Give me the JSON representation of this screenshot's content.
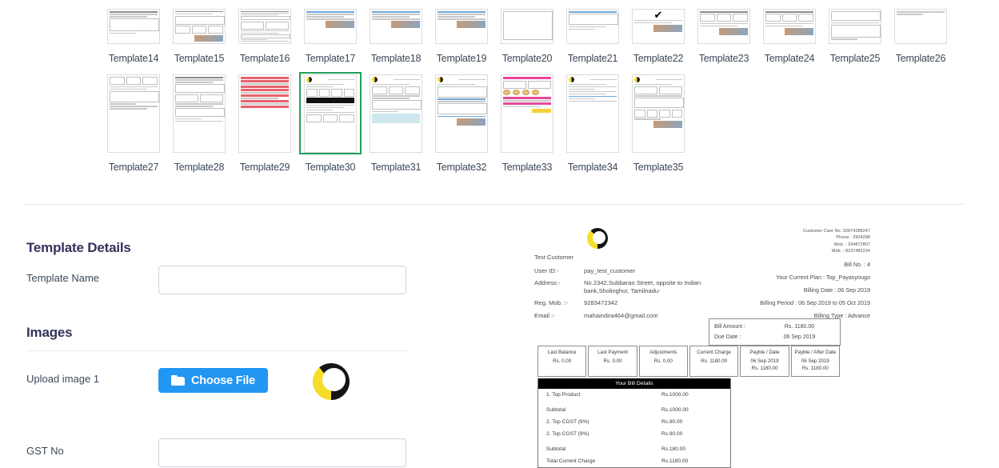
{
  "gallery": {
    "rows": [
      {
        "items": [
          {
            "label": "Template14",
            "selected": false,
            "art": "form-photo"
          },
          {
            "label": "Template15",
            "selected": false,
            "art": "table-photo"
          },
          {
            "label": "Template16",
            "selected": false,
            "art": "dense-form"
          },
          {
            "label": "Template17",
            "selected": false,
            "art": "blue-photo"
          },
          {
            "label": "Template18",
            "selected": false,
            "art": "blue-photo"
          },
          {
            "label": "Template19",
            "selected": false,
            "art": "blue-photo"
          },
          {
            "label": "Template20",
            "selected": false,
            "art": "plain-box"
          },
          {
            "label": "Template21",
            "selected": false,
            "art": "blue-table"
          },
          {
            "label": "Template22",
            "selected": false,
            "art": "check-photo"
          },
          {
            "label": "Template23",
            "selected": false,
            "art": "invoice-photo"
          },
          {
            "label": "Template24",
            "selected": false,
            "art": "invoice-photo"
          },
          {
            "label": "Template25",
            "selected": false,
            "art": "terms-table"
          },
          {
            "label": "Template26",
            "selected": false,
            "art": "faint"
          }
        ]
      },
      {
        "items": [
          {
            "label": "Template27",
            "selected": false,
            "art": "grey-table"
          },
          {
            "label": "Template28",
            "selected": false,
            "art": "dense-form"
          },
          {
            "label": "Template29",
            "selected": false,
            "art": "red-lines"
          },
          {
            "label": "Template30",
            "selected": true,
            "art": "brand-invoice"
          },
          {
            "label": "Template31",
            "selected": false,
            "art": "tint-invoice"
          },
          {
            "label": "Template32",
            "selected": false,
            "art": "blue-banded"
          },
          {
            "label": "Template33",
            "selected": false,
            "art": "pink-catalog"
          },
          {
            "label": "Template34",
            "selected": false,
            "art": "brand-letter"
          },
          {
            "label": "Template35",
            "selected": false,
            "art": "grid-invoice"
          }
        ]
      }
    ]
  },
  "form": {
    "template_details_title": "Template Details",
    "template_name_label": "Template Name",
    "template_name_value": "",
    "images_title": "Images",
    "upload_image_label": "Upload image 1",
    "choose_file_label": "Choose File",
    "gst_no_label": "GST No",
    "gst_no_value": ""
  },
  "invoice": {
    "customer_name": "Test Customer",
    "fields": [
      {
        "key": "User ID:-",
        "value": "pay_test_customer"
      },
      {
        "key": "Address:-",
        "value": "No.2342,Subbarao Street, oppsite to Indian bank,Sholinghur, Tamilnadu-"
      },
      {
        "key": "Reg. Mob. :-",
        "value": "9283472342"
      },
      {
        "key": "Email :-",
        "value": "mahaindira464@gmail.com"
      }
    ],
    "care_lines": [
      "Customer Care No. 92874288247",
      "Phone : 2904288",
      "Mob. : 294872807",
      "Mob. : 8237482234"
    ],
    "right_lines": [
      "Bill No. : 4",
      "Your Current Plan : Top_Payasyougo",
      "Billing Date : 06 Sep 2019",
      "Billing Period : 06 Sep 2019 to 05 Oct 2019",
      "Billing Type : Advance"
    ],
    "amount_box": [
      {
        "key": "Bill Amount :",
        "value": "Rs. 1180.00"
      },
      {
        "key": "Due Date :",
        "value": "06 Sep 2019"
      }
    ],
    "balance_cells": [
      {
        "title": "Last Balance",
        "body": "Rs. 0.00"
      },
      {
        "title": "Last Payment",
        "body": "Rs. 0.00"
      },
      {
        "title": "Adjustments",
        "body": "Rs. 0.00"
      },
      {
        "title": "Current Charge",
        "body": "Rs. 1180.00"
      },
      {
        "title": "Payble / Date",
        "body": "06 Sep 2019\nRs. 1180.00"
      },
      {
        "title": "Payble / After Date",
        "body": "06 Sep 2019\nRs. 1180.00"
      }
    ],
    "bill_details_title": "Your Bill Details",
    "bill_rows": [
      {
        "name": "1. Top Product",
        "amount": "Rs.1000.00",
        "gap": false
      },
      {
        "name": "Subtotal",
        "amount": "Rs.1000.00",
        "gap": true
      },
      {
        "name": "2. Top CGST (9%)",
        "amount": "Rs.90.00",
        "gap": false
      },
      {
        "name": "2. Top CGST (9%)",
        "amount": "Rs.90.00",
        "gap": false
      },
      {
        "name": "Subtotal",
        "amount": "Rs.180.00",
        "gap": true
      },
      {
        "name": "Total Current Charge",
        "amount": "Rs.1180.00",
        "gap": false
      }
    ]
  },
  "colors": {
    "selected_border": "#22a05a",
    "button_blue": "#2196f3",
    "label_text": "#3c4858",
    "brand_yellow": "#f5dd2a",
    "brand_black": "#151515"
  }
}
